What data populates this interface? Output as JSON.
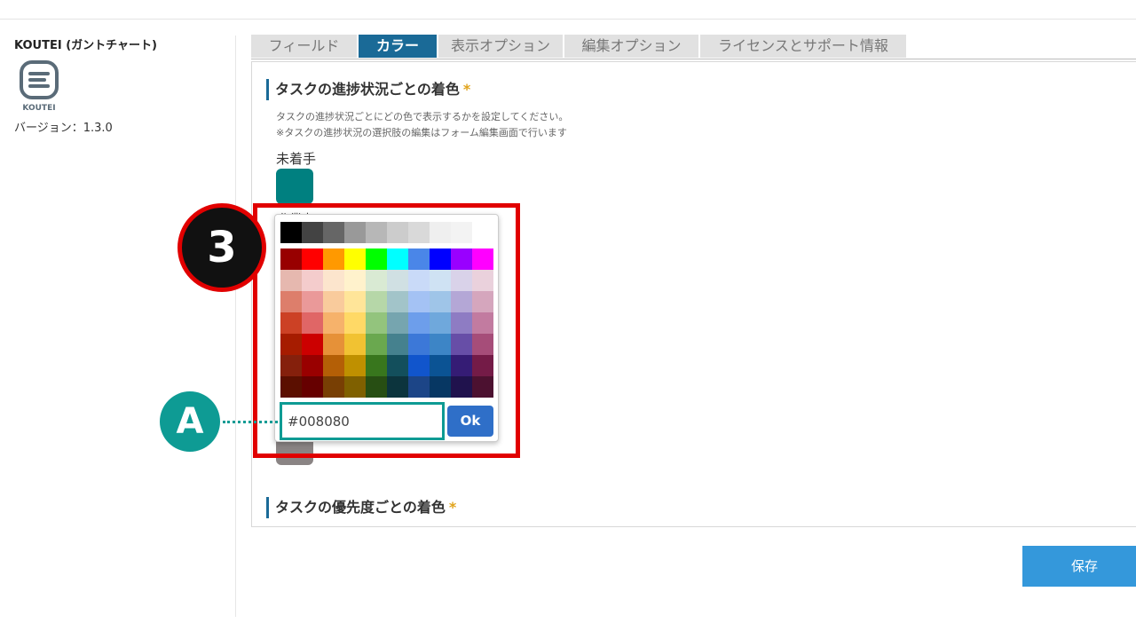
{
  "app": {
    "name": "KOUTEI (ガントチャート)",
    "logo_text": "KOUTEI",
    "version": "バージョン：1.3.0"
  },
  "tabs": [
    {
      "label": "フィールド",
      "active": false
    },
    {
      "label": "カラー",
      "active": true
    },
    {
      "label": "表示オプション",
      "active": false
    },
    {
      "label": "編集オプション",
      "active": false
    },
    {
      "label": "ライセンスとサポート情報",
      "active": false
    }
  ],
  "section_status": {
    "title": "タスクの進捗状況ごとの着色",
    "required_mark": "*",
    "desc1": "タスクの進捗状況ごとにどの色で表示するかを設定してください。",
    "desc2": "※タスクの進捗状況の選択肢の編集はフォーム編集画面で行います",
    "status_label": "未着手",
    "partial_label": "作業中"
  },
  "section_priority": {
    "title": "タスクの優先度ごとの着色",
    "required_mark": "*"
  },
  "picker": {
    "hex_value": "#008080",
    "ok_label": "Ok",
    "gray_row": [
      "#000000",
      "#434343",
      "#666666",
      "#999999",
      "#b7b7b7",
      "#cccccc",
      "#d9d9d9",
      "#efefef",
      "#f3f3f3",
      "#ffffff"
    ],
    "palette": [
      [
        "#980000",
        "#ff0000",
        "#ff9900",
        "#ffff00",
        "#00ff00",
        "#00ffff",
        "#4a86e8",
        "#0000ff",
        "#9900ff",
        "#ff00ff"
      ],
      [
        "#e6b8af",
        "#f4cccc",
        "#fce5cd",
        "#fff2cc",
        "#d9ead3",
        "#d0e0e3",
        "#c9daf8",
        "#cfe2f3",
        "#d9d2e9",
        "#ead1dc"
      ],
      [
        "#dd7e6b",
        "#ea9999",
        "#f9cb9c",
        "#ffe599",
        "#b6d7a8",
        "#a2c4c9",
        "#a4c2f4",
        "#9fc5e8",
        "#b4a7d6",
        "#d5a6bd"
      ],
      [
        "#cc4125",
        "#e06666",
        "#f6b26b",
        "#ffd966",
        "#93c47d",
        "#76a5af",
        "#6d9eeb",
        "#6fa8dc",
        "#8e7cc3",
        "#c27ba0"
      ],
      [
        "#a61c00",
        "#cc0000",
        "#e69138",
        "#f1c232",
        "#6aa84f",
        "#45818e",
        "#3c78d8",
        "#3d85c6",
        "#674ea7",
        "#a64d79"
      ],
      [
        "#85200c",
        "#990000",
        "#b45f06",
        "#bf9000",
        "#38761d",
        "#134f5c",
        "#1155cc",
        "#0b5394",
        "#351c75",
        "#741b47"
      ],
      [
        "#5b0f00",
        "#660000",
        "#783f04",
        "#7f6000",
        "#274e13",
        "#0c343d",
        "#1c4587",
        "#073763",
        "#20124d",
        "#4c1130"
      ]
    ]
  },
  "annotations": {
    "step_number": "3",
    "marker_label": "A"
  },
  "save_label": "保存",
  "colors": {
    "accent": "#1a6a97",
    "annotation_red": "#e10000",
    "annotation_teal": "#0e9b94",
    "save_blue": "#3498db",
    "selected_swatch": "#008080"
  }
}
